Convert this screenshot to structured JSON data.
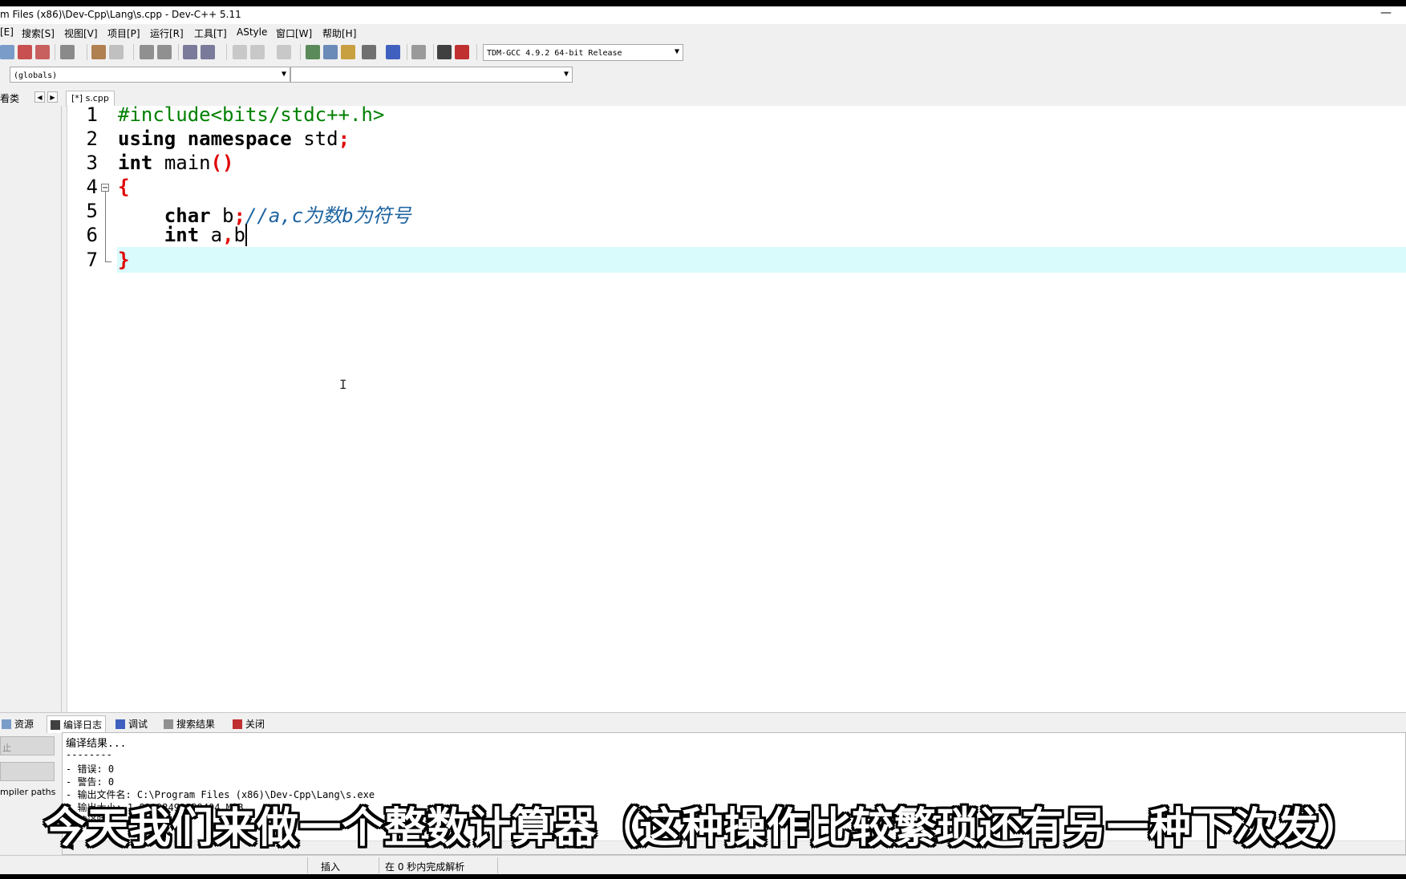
{
  "window": {
    "title": "m Files (x86)\\Dev-Cpp\\Lang\\s.cpp - Dev-C++ 5.11",
    "minimize_glyph": "—"
  },
  "menu": [
    {
      "label": "[E]"
    },
    {
      "label": "搜索[S]"
    },
    {
      "label": "视图[V]"
    },
    {
      "label": "项目[P]"
    },
    {
      "label": "运行[R]"
    },
    {
      "label": "工具[T]"
    },
    {
      "label": "AStyle"
    },
    {
      "label": "窗口[W]"
    },
    {
      "label": "帮助[H]"
    }
  ],
  "toolbar": {
    "compiler": "TDM-GCC 4.9.2 64-bit Release",
    "scope": "(globals)",
    "member": ""
  },
  "left_panel": {
    "tab_label": "看类",
    "compiler_paths_label": "mpiler paths"
  },
  "file_tab": "[*] s.cpp",
  "editor": {
    "line_numbers": [
      "1",
      "2",
      "3",
      "4",
      "5",
      "6",
      "7"
    ],
    "fold_marker": "−"
  },
  "code": {
    "l1": "#include<bits/stdc++.h>",
    "l2_kw1": "using",
    "l2_kw2": "namespace",
    "l2_id": "std",
    "l2_sym": ";",
    "l3_kw": "int",
    "l3_id": "main",
    "l3_sym": "()",
    "l4_sym": "{",
    "l5_indent": "    ",
    "l5_kw": "char",
    "l5_id": "b",
    "l5_sym": ";",
    "l5_comment": "//a,c为数b为符号",
    "l6_indent": "    ",
    "l6_kw": "int",
    "l6_id1": "a",
    "l6_sym": ",",
    "l6_id2": "b",
    "l7_sym": "}"
  },
  "bottom_tabs": [
    {
      "label": "资源",
      "icon": "resource-icon"
    },
    {
      "label": "编译日志",
      "icon": "chart-icon"
    },
    {
      "label": "调试",
      "icon": "check-icon"
    },
    {
      "label": "搜索结果",
      "icon": "search-icon"
    },
    {
      "label": "关闭",
      "icon": "close-icon"
    }
  ],
  "compile_log": [
    "编译结果...",
    "--------",
    "- 错误: 0",
    "- 警告: 0",
    "- 输出文件名: C:\\Program Files (x86)\\Dev-Cpp\\Lang\\s.exe",
    "- 输出大小: 1.83193492889404 MiB",
    "- 编译时"
  ],
  "left_buttons": [
    "止",
    ""
  ],
  "status": {
    "mode": "插入",
    "parse": "在 0 秒内完成解析"
  },
  "subtitle": "今天我们来做一个整数计算器（这种操作比较繁琐还有另一种下次发）",
  "colors": {
    "keyword": "#000000",
    "preprocessor": "#008000",
    "symbol": "#e00000",
    "comment": "#1e64a0",
    "current_line": "#d9fbfb"
  }
}
